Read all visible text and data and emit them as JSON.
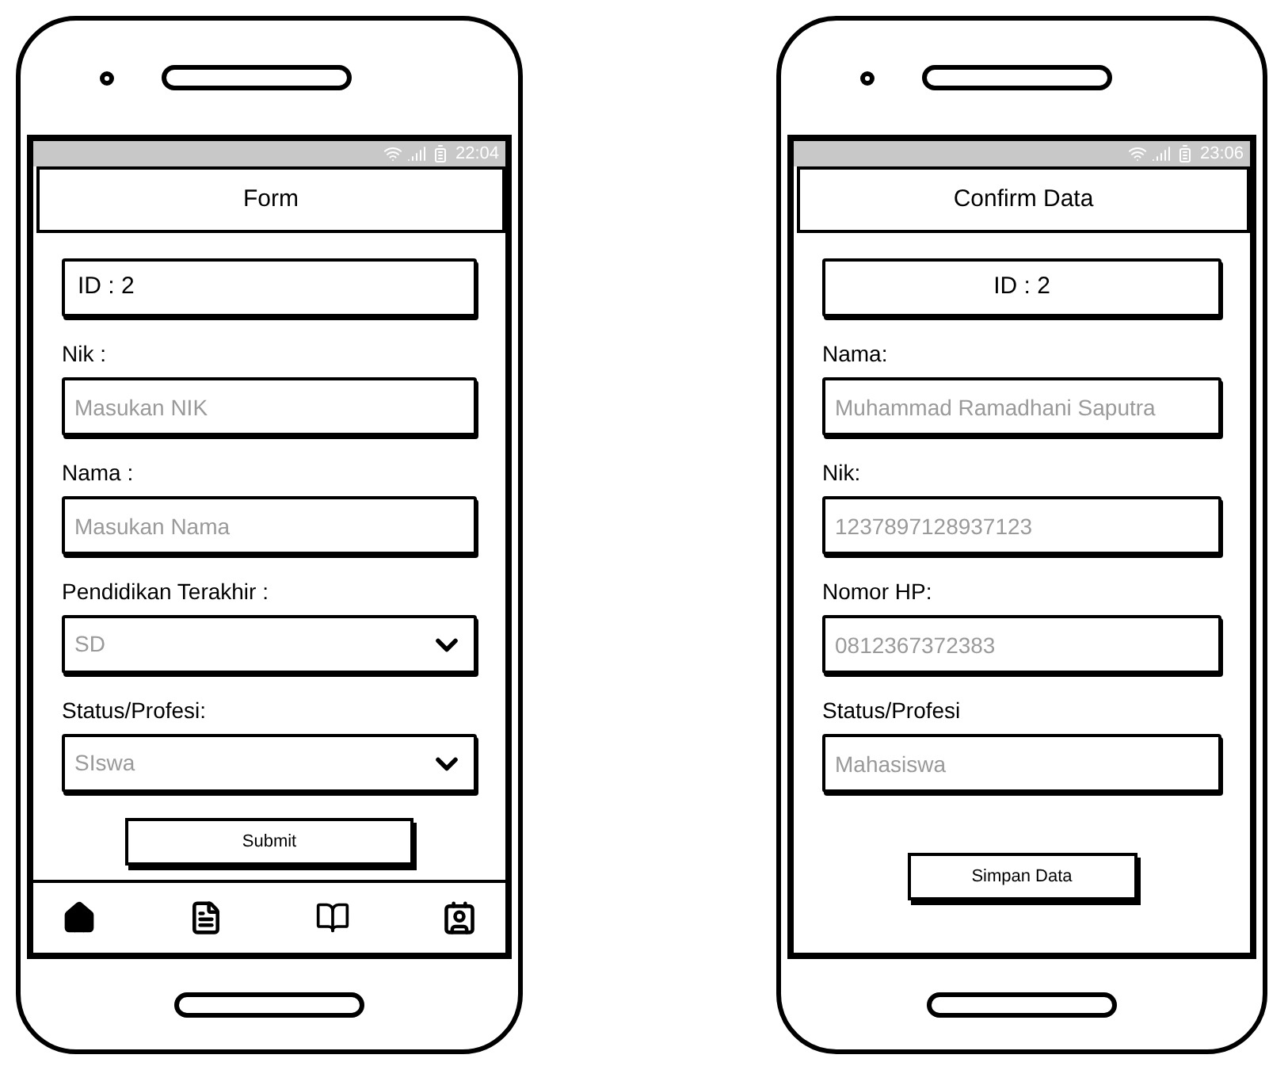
{
  "phones": [
    {
      "status_bar": {
        "time": "22:04"
      },
      "title": "Form",
      "bottom_nav": true,
      "fields": [
        {
          "kind": "box",
          "text": "ID : 2",
          "centered": false
        },
        {
          "kind": "input",
          "label": "Nik :",
          "placeholder": "Masukan NIK"
        },
        {
          "kind": "input",
          "label": "Nama :",
          "placeholder": "Masukan Nama"
        },
        {
          "kind": "select",
          "label": "Pendidikan Terakhir :",
          "value": "SD"
        },
        {
          "kind": "select",
          "label": "Status/Profesi:",
          "value": "SIswa"
        }
      ],
      "button": "Submit"
    },
    {
      "status_bar": {
        "time": "23:06"
      },
      "title": "Confirm Data",
      "bottom_nav": false,
      "fields": [
        {
          "kind": "box",
          "text": "ID : 2",
          "centered": true
        },
        {
          "kind": "input",
          "label": "Nama:",
          "placeholder": "Muhammad Ramadhani Saputra"
        },
        {
          "kind": "input",
          "label": "Nik:",
          "placeholder": "1237897128937123"
        },
        {
          "kind": "input",
          "label": "Nomor HP:",
          "placeholder": "0812367372383"
        },
        {
          "kind": "input",
          "label": "Status/Profesi",
          "placeholder": "Mahasiswa"
        }
      ],
      "button": "Simpan Data"
    }
  ]
}
